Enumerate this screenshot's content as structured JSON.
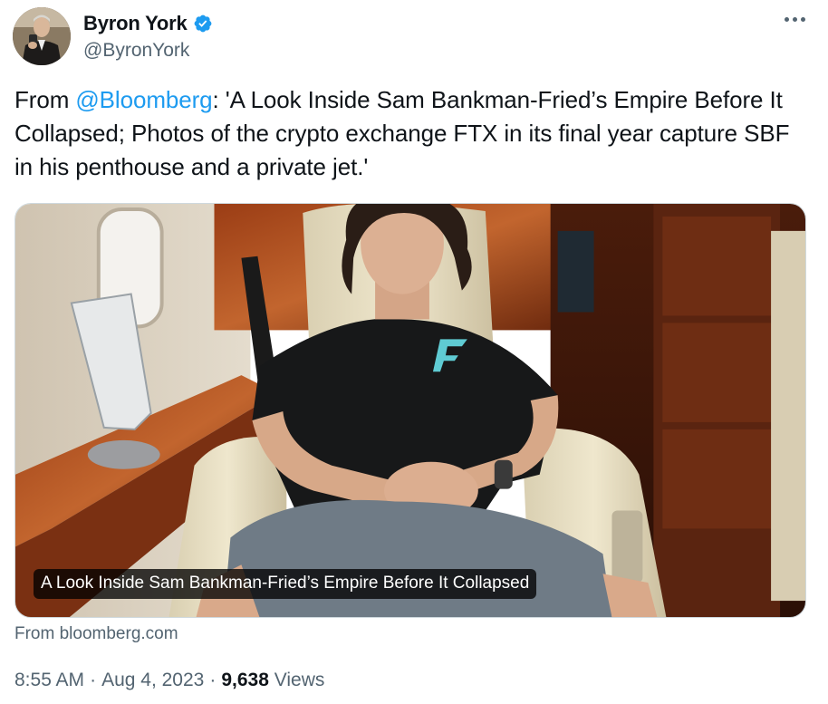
{
  "author": {
    "display_name": "Byron York",
    "handle": "@ByronYork",
    "verified": true,
    "verified_color": "#1d9bf0"
  },
  "tweet": {
    "text_prefix": "From ",
    "mention": "@Bloomberg",
    "text_body": ": 'A Look Inside Sam Bankman-Fried’s Empire Before It Collapsed; Photos of the crypto exchange FTX in its final year capture SBF in his penthouse and a private jet.'"
  },
  "card": {
    "caption": "A Look Inside Sam Bankman-Fried’s Empire Before It Collapsed",
    "source": "From bloomberg.com"
  },
  "meta": {
    "time": "8:55 AM",
    "date": "Aug 4, 2023",
    "views_count": "9,638",
    "views_label": "Views",
    "separator": "·"
  },
  "colors": {
    "text_primary": "#0f1419",
    "text_secondary": "#536471",
    "link": "#1d9bf0"
  }
}
